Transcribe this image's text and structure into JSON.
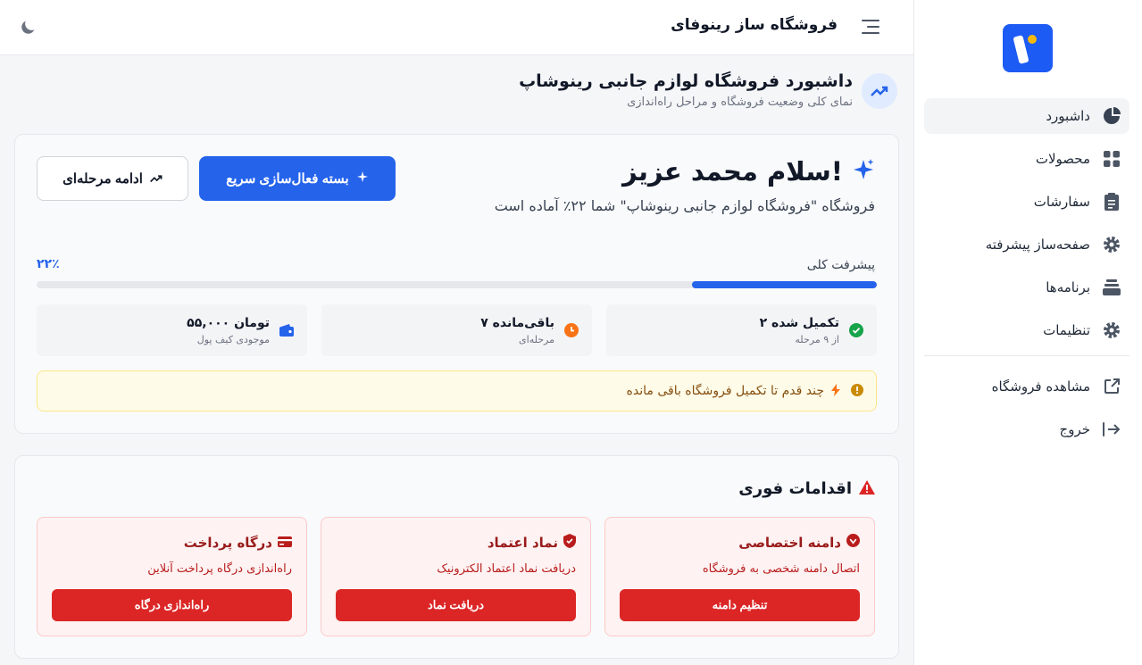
{
  "header": {
    "app_title": "فروشگاه ساز رینوفای",
    "theme_icon": "moon-icon",
    "menu_icon": "menu-icon"
  },
  "sidebar": {
    "items": [
      {
        "label": "داشبورد",
        "icon": "pie-chart-icon",
        "active": true
      },
      {
        "label": "محصولات",
        "icon": "grid-icon",
        "active": false
      },
      {
        "label": "سفارشات",
        "icon": "clipboard-icon",
        "active": false
      },
      {
        "label": "صفحه‌ساز پیشرفته",
        "icon": "gear-icon",
        "active": false
      },
      {
        "label": "برنامه‌ها",
        "icon": "layers-icon",
        "active": false
      },
      {
        "label": "تنظیمات",
        "icon": "gear-icon",
        "active": false
      }
    ],
    "bottom_items": [
      {
        "label": "مشاهده فروشگاه",
        "icon": "external-link-icon"
      },
      {
        "label": "خروج",
        "icon": "logout-icon"
      }
    ]
  },
  "page": {
    "title": "داشبورد فروشگاه لوازم جانبی رینوشاپ",
    "subtitle": "نمای کلی وضعیت فروشگاه و مراحل راه‌اندازی"
  },
  "welcome": {
    "greeting": "سلام محمد عزیز!",
    "subtitle": "فروشگاه \"فروشگاه لوازم جانبی رینوشاپ\" شما ۲۲٪ آماده است",
    "primary_button": "بسته فعال‌سازی سریع",
    "secondary_button": "ادامه مرحله‌ای",
    "progress_label": "پیشرفت کلی",
    "progress_percent_text": "۲۲٪",
    "progress_value": 22,
    "stats": [
      {
        "value": "۲ تکمیل شده",
        "caption": "از ۹ مرحله",
        "icon": "check-circle-icon"
      },
      {
        "value": "۷ باقی‌مانده",
        "caption": "مرحله‌ای",
        "icon": "clock-icon"
      },
      {
        "value": "۵۵,۰۰۰ تومان",
        "caption": "موجودی کیف پول",
        "icon": "wallet-icon"
      }
    ],
    "alert": "چند قدم تا تکمیل فروشگاه باقی مانده"
  },
  "actions": {
    "title": "اقدامات فوری",
    "cards": [
      {
        "title": "دامنه اختصاصی",
        "desc": "اتصال دامنه شخصی به فروشگاه",
        "button": "تنظیم دامنه",
        "icon": "globe-icon"
      },
      {
        "title": "نماد اعتماد",
        "desc": "دریافت نماد اعتماد الکترونیک",
        "button": "دریافت نماد",
        "icon": "shield-icon"
      },
      {
        "title": "درگاه پرداخت",
        "desc": "راه‌اندازی درگاه پرداخت آنلاین",
        "button": "راه‌اندازی درگاه",
        "icon": "credit-card-icon"
      }
    ]
  },
  "colors": {
    "primary": "#2563eb",
    "danger": "#dc2626",
    "success": "#16a34a",
    "warning": "#f97316"
  }
}
